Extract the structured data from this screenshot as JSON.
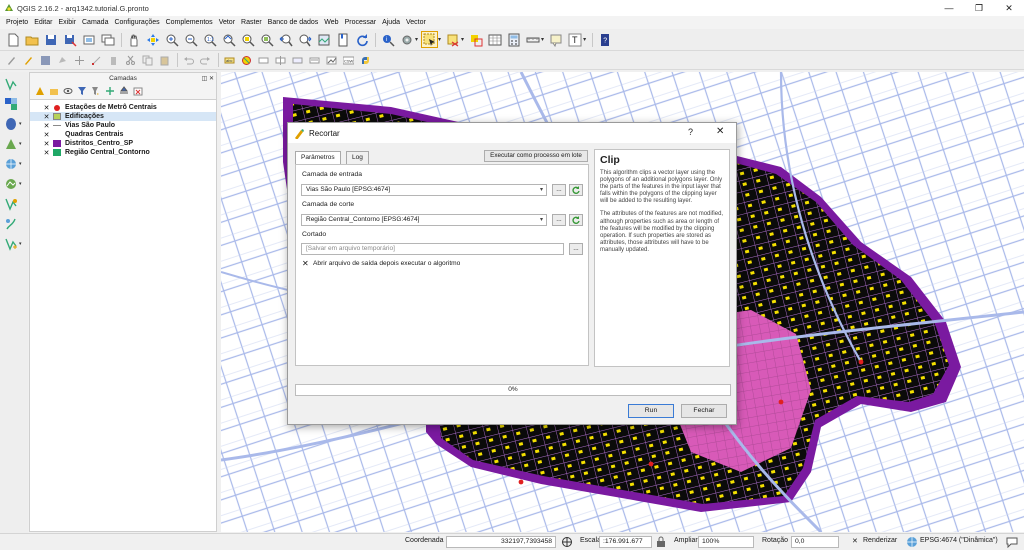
{
  "window": {
    "title": "QGIS 2.16.2 - arq1342.tutorial.G.pronto",
    "minimize": "—",
    "restore": "❐",
    "close": "✕"
  },
  "menu": [
    "Projeto",
    "Editar",
    "Exibir",
    "Camada",
    "Configurações",
    "Complementos",
    "Vetor",
    "Raster",
    "Banco de dados",
    "Web",
    "Processar",
    "Ajuda",
    "Vector"
  ],
  "layers_panel": {
    "title": "Camadas",
    "controls": "◫ ✕",
    "layers": [
      {
        "label": "Estações de Metrô Centrais",
        "symbol": "point",
        "color": "#e02020",
        "checked": "✕"
      },
      {
        "label": "Edificações",
        "symbol": "fill",
        "color": "#b7d25a",
        "checked": "✕"
      },
      {
        "label": "Vias São Paulo",
        "symbol": "line",
        "color": "#8a8a8a",
        "checked": "✕"
      },
      {
        "label": "Quadras Centrais",
        "symbol": "fill",
        "color": "#ffffff",
        "checked": "✕"
      },
      {
        "label": "Distritos_Centro_SP",
        "symbol": "fill",
        "color": "#7a1aa0",
        "checked": "✕"
      },
      {
        "label": "Região Central_Contorno",
        "symbol": "fill",
        "color": "#1fa866",
        "checked": "✕"
      }
    ]
  },
  "dialog": {
    "title": "Recortar",
    "help_button": "?",
    "close_button": "✕",
    "tabs": [
      "Parâmetros",
      "Log"
    ],
    "batch_button": "Executar como processo em lote",
    "input_label": "Camada de entrada",
    "input_value": "Vias São Paulo [EPSG:4674]",
    "clip_label": "Camada de corte",
    "clip_value": "Região Central_Contorno [EPSG:4674]",
    "output_label": "Cortado",
    "output_placeholder": "[Salvar em arquivo temporário]",
    "browse_label": "...",
    "combo_arrow": "▾",
    "open_output_checked": "✕",
    "open_output_label": "Abrir arquivo de saída depois executar o algoritmo",
    "help_title": "Clip",
    "help_p1": "This algorithm clips a vector layer using the polygons of an additional polygons layer. Only the parts of the features in the input layer that falls within the polygons of the clipping layer will be added to the resulting layer.",
    "help_p2": "The attributes of the features are not modified, although properties such as area or length of the features will be modified by the clipping operation. If such properties are stored as attributes, those attributes will have to be manually updated.",
    "progress_value": 0,
    "progress_text": "0%",
    "run_button": "Run",
    "close_dialog_button": "Fechar"
  },
  "statusbar": {
    "coord_label": "Coordenada",
    "coord_value": "332197,7393458",
    "scale_label": "Escala",
    "scale_value": ":176.991.677",
    "zoom_label": "Ampliar",
    "zoom_value": "100%",
    "rotation_label": "Rotação",
    "rotation_value": "0,0",
    "render_checked": "✕",
    "render_label": "Renderizar",
    "crs_label": "EPSG:4674 (\"Dinâmica\")"
  },
  "colors": {
    "district_purple": "#7a1aa0",
    "building_yellow": "#f5e100",
    "block_black": "#0b0b0b",
    "street_blue": "#a9b9ea",
    "centre_pink": "#d85ab8",
    "selection_orange": "#e0a000"
  },
  "icons": {
    "toolbar1": [
      "new-project-icon",
      "open-project-icon",
      "save-project-icon",
      "save-as-icon",
      "print-composer-icon",
      "composer-manager-icon",
      "pan-icon",
      "pan-to-selection-icon",
      "zoom-in-icon",
      "zoom-out-icon",
      "zoom-actual-icon",
      "zoom-full-icon",
      "zoom-to-selection-icon",
      "zoom-to-layer-icon",
      "zoom-last-icon",
      "zoom-next-icon",
      "new-map-view-icon",
      "bookmarks-icon",
      "refresh-icon",
      "identify-icon",
      "action-icon",
      "select-features-icon",
      "deselect-icon",
      "attribute-table-icon",
      "field-calculator-icon",
      "measure-icon",
      "annotation-icon",
      "text-annotation-icon",
      "help-icon"
    ],
    "toolbar2": [
      "edits-icon",
      "toggle-edit-icon",
      "save-edits-icon",
      "add-feature-icon",
      "move-feature-icon",
      "node-tool-icon",
      "delete-icon",
      "cut-icon",
      "copy-icon",
      "paste-icon",
      "undo-icon",
      "redo-icon",
      "label-icon",
      "label-pin-icon",
      "label-show-icon",
      "label-move-icon",
      "label-rotate-icon",
      "label-change-icon",
      "digitize-icon",
      "csw-icon",
      "python-icon"
    ]
  }
}
